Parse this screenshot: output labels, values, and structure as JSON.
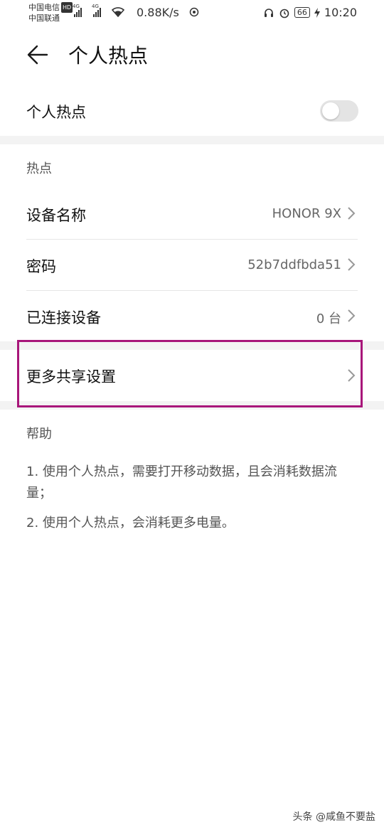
{
  "status_bar": {
    "carrier_1": "中国电信",
    "hd_badge": "HD",
    "carrier_2": "中国联通",
    "network_1": "4G",
    "network_2": "4G",
    "speed": "0.88K/s",
    "battery": "66",
    "time": "10:20"
  },
  "header": {
    "title": "个人热点"
  },
  "hotspot_toggle": {
    "label": "个人热点",
    "state": "off"
  },
  "hotspot_section": {
    "heading": "热点",
    "rows": [
      {
        "label": "设备名称",
        "value": "HONOR 9X"
      },
      {
        "label": "密码",
        "value": "52b7ddfbda51"
      },
      {
        "label": "已连接设备",
        "value": "0 台"
      }
    ]
  },
  "more_sharing": {
    "label": "更多共享设置"
  },
  "help": {
    "heading": "帮助",
    "line_1": "1. 使用个人热点，需要打开移动数据，且会消耗数据流量；",
    "line_2": "2. 使用个人热点，会消耗更多电量。"
  },
  "watermark": "头条 @咸鱼不要盐",
  "colors": {
    "highlight": "#a8167a",
    "toggle_off": "#e4e4e4",
    "band": "#f3f3f3"
  }
}
